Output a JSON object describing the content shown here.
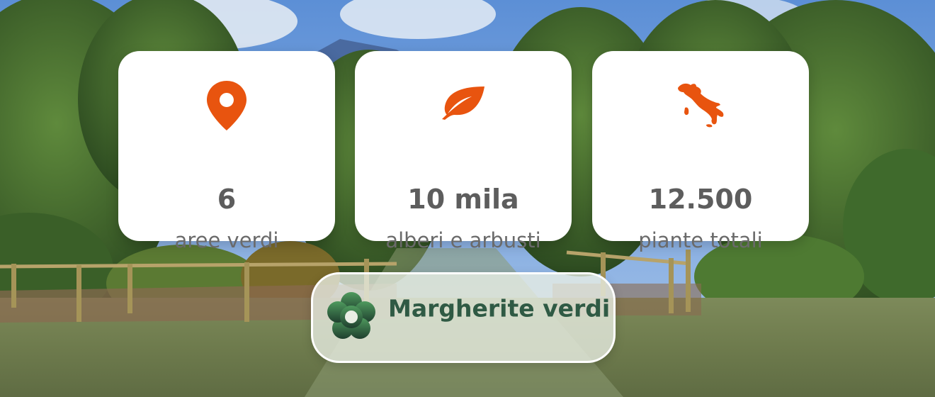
{
  "stats": [
    {
      "icon": "location-pin-icon",
      "value": "6",
      "label": "aree verdi"
    },
    {
      "icon": "leaf-icon",
      "value": "10 mila",
      "label": "alberi e arbusti"
    },
    {
      "icon": "italy-map-icon",
      "value": "12.500",
      "label": "piante totali"
    }
  ],
  "brand": {
    "name": "Margherite verdi",
    "icon": "flower-logo-icon"
  },
  "colors": {
    "accent": "#e8540f",
    "brand_text": "#2f5a44",
    "card_bg": "#ffffff",
    "value_text": "#5d5d5d"
  }
}
